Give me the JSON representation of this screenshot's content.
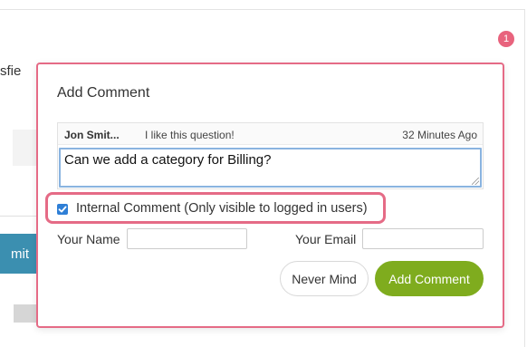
{
  "background": {
    "partial_heading": "sfie",
    "partial_button": "mit",
    "notification_count": "1"
  },
  "modal": {
    "title": "Add Comment",
    "existing_comment": {
      "author": "Jon Smit...",
      "text": "I like this question!",
      "time": "32 Minutes Ago"
    },
    "textarea_value": "Can we add a category for Billing?",
    "internal_checkbox": {
      "checked": true,
      "label": "Internal Comment (Only visible to logged in users)"
    },
    "fields": {
      "name_label": "Your Name",
      "name_value": "",
      "email_label": "Your Email",
      "email_value": ""
    },
    "buttons": {
      "cancel_label": "Never Mind",
      "submit_label": "Add Comment"
    }
  },
  "colors": {
    "highlight": "#e56b86",
    "submit": "#7fac1e",
    "badge": "#e8637d",
    "checkbox": "#2f7fd6"
  }
}
